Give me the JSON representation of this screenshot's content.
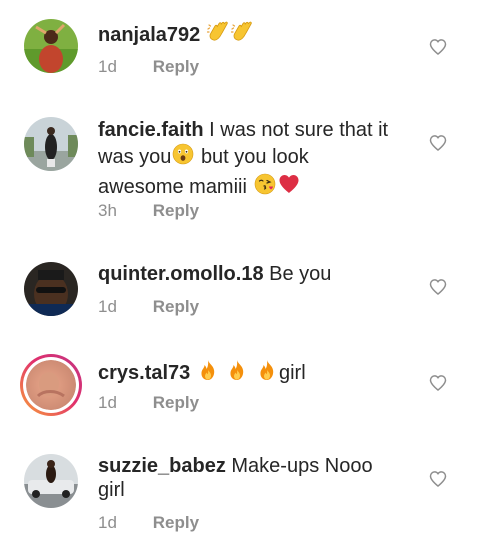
{
  "comments": [
    {
      "username": "nanjala792",
      "text": "",
      "emojis": "clap-clap",
      "time": "1d",
      "reply": "Reply"
    },
    {
      "username": "fancie.faith",
      "text_1": "I was not sure that it was you",
      "text_2": "but you look awesome mamiii",
      "time": "3h",
      "reply": "Reply"
    },
    {
      "username": "quinter.omollo.18",
      "text": "Be you",
      "time": "1d",
      "reply": "Reply"
    },
    {
      "username": "crys.tal73",
      "text": "girl",
      "emojis": "fire-fire-fire",
      "time": "1d",
      "reply": "Reply"
    },
    {
      "username": "suzzie_babez",
      "text": "Make-ups Nooo girl",
      "time": "1d",
      "reply": "Reply"
    }
  ],
  "colors": {
    "text": "#262626",
    "meta": "#8e8e8e",
    "story_ring_start": "#f9a23a",
    "story_ring_end": "#c13584"
  },
  "icons": [
    "heart-outline-icon",
    "clap-emoji-icon",
    "astonished-emoji-icon",
    "kiss-emoji-icon",
    "red-heart-emoji-icon",
    "fire-emoji-icon"
  ]
}
